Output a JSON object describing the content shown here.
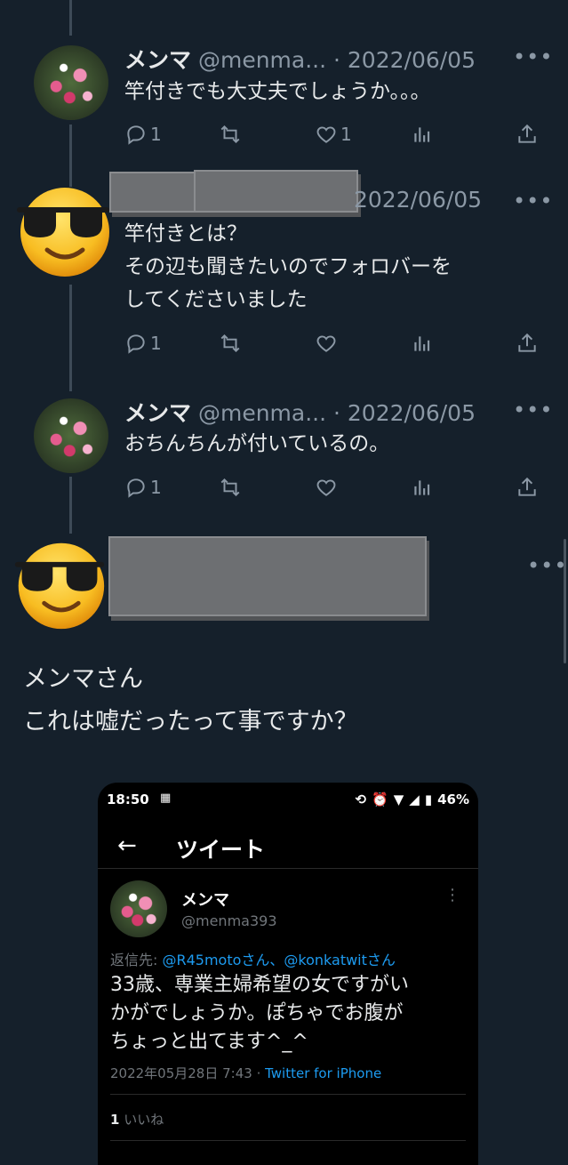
{
  "tweets": [
    {
      "name": "メンマ",
      "meta": "@menma... · 2022/06/05",
      "lines": [
        "竿付きでも大丈夫でしょうか。。。"
      ],
      "replies": "1",
      "retweets": "",
      "likes": "1"
    },
    {
      "name": "",
      "meta": "2022/06/05",
      "lines": [
        "竿付きとは？",
        "その辺も聞きたいのでフォロバーを",
        "してくださいました"
      ],
      "replies": "1",
      "retweets": "",
      "likes": ""
    },
    {
      "name": "メンマ",
      "meta": "@menma... · 2022/06/05",
      "lines": [
        "おちんちんが付いているの。"
      ],
      "replies": "1",
      "retweets": "",
      "likes": ""
    }
  ],
  "main_tweet": {
    "lines": [
      "メンマさん",
      "これは嘘だったって事ですか？"
    ]
  },
  "embedded_screenshot": {
    "status_time": "18:50",
    "status_battery": "46%",
    "header_title": "ツイート",
    "name": "メンマ",
    "handle": "@menma393",
    "reply_prefix": "返信先: ",
    "reply_to": "@R45motoさん、@konkatwitさん",
    "body_lines": [
      "33歳、専業主婦希望の女ですがい",
      "かがでしょうか。ぽちゃでお腹が",
      "ちょっと出てます^_^"
    ],
    "date": "2022年05月28日 7:43 · ",
    "via": "Twitter for iPhone",
    "likes_count": "1",
    "likes_label": "いいね"
  },
  "icons": {
    "reply": "reply-icon",
    "retweet": "retweet-icon",
    "like": "heart-icon",
    "views": "analytics-icon",
    "share": "share-icon",
    "more": "more-icon",
    "emoji": "sunglasses-emoji"
  },
  "colors": {
    "background": "#15202b",
    "text": "#e7e9ea",
    "secondary": "#8b98a5",
    "link": "#1d9bf0"
  }
}
